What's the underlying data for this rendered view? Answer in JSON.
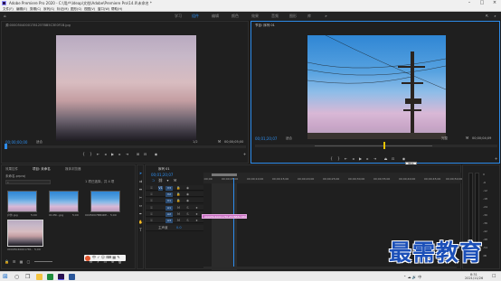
{
  "window": {
    "title": "Adobe Premiere Pro 2020 - C:\\用户\\Ideap\\文档\\Adobe\\Premiere Pro\\14.0\\未命名 *",
    "min_icon": "minimize-icon",
    "max_icon": "maximize-icon",
    "close_icon": "close-icon"
  },
  "menu": [
    "文件(F)",
    "编辑(E)",
    "剪辑(C)",
    "序列(S)",
    "标记(M)",
    "图形(G)",
    "视图(V)",
    "窗口(W)",
    "帮助(H)"
  ],
  "workspaces": [
    {
      "label": "学习",
      "active": false
    },
    {
      "label": "组件",
      "active": true
    },
    {
      "label": "编辑",
      "active": false
    },
    {
      "label": "颜色",
      "active": false
    },
    {
      "label": "效果",
      "active": false
    },
    {
      "label": "音频",
      "active": false
    },
    {
      "label": "图形",
      "active": false
    },
    {
      "label": "库",
      "active": false
    }
  ],
  "source_monitor": {
    "tab": "源:00005040001781257BB5C3E0F1B.jpg",
    "timecode_left": "00;00;00;00",
    "fit": "适合",
    "fraction": "1/2",
    "timecode_right": "00;00;05;00"
  },
  "program_monitor": {
    "tab": "节目: 序列 01",
    "timecode_left": "00;01;20;07",
    "fit": "适合",
    "fraction": "完整",
    "timecode_right": "00;00;04;09",
    "tooltip": "提升"
  },
  "project_panel": {
    "tabs": [
      "效果控件",
      "项目: 未命名",
      "媒体浏览器"
    ],
    "path": "未命名.prproj",
    "search_placeholder": "",
    "count_label": "1 项已选择，共 4 项",
    "items": [
      {
        "name": "户外.jpg",
        "duration": "5;00",
        "sky": "sky2"
      },
      {
        "name": "01df9...jpg",
        "duration": "5;00",
        "sky": "sky2"
      },
      {
        "name": "0005D07BB4DE...jpg",
        "duration": "5;00",
        "sky": "sky2"
      },
      {
        "name": "00005040001781...",
        "duration": "5;00",
        "sky": "sky1"
      }
    ]
  },
  "timeline": {
    "tab": "序列 01",
    "timecode": "00;01;20;07",
    "ruler": [
      ":00;00",
      "00;00;05;00",
      "00;00;10;00",
      "00;00;15;00",
      "00;00;20;00",
      "00;00;25;00",
      "00;00;30;00",
      "00;00;35;00",
      "00;00;40;00",
      "00;00;45;00",
      "00;00;50;00"
    ],
    "tracks": [
      "V3",
      "V2",
      "V1",
      "A1",
      "A2",
      "A3"
    ],
    "master_label": "主声道",
    "master_value": "0.0",
    "clip_label": "00005040001781257BB5C3E0F1B.jpg"
  },
  "audio_meter": {
    "labels": [
      "0",
      "-6",
      "-12",
      "-18",
      "-24",
      "-30",
      "-36",
      "-42",
      "-48",
      "-54",
      "dB"
    ],
    "solo": "S"
  },
  "taskbar": {
    "time": "8:31",
    "date": "2021/11/26"
  },
  "watermark": "最需教育"
}
